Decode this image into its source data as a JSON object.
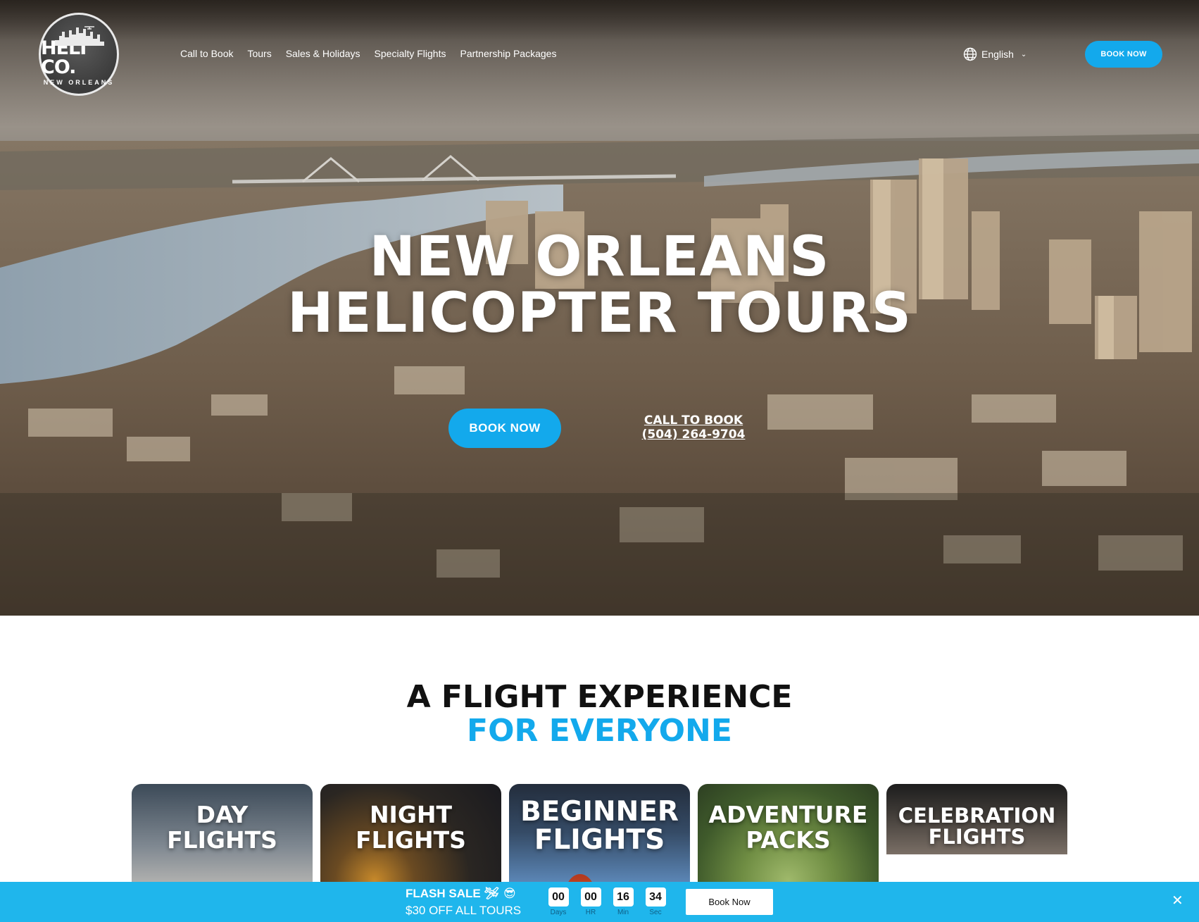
{
  "header": {
    "logo_brand": "HELI CO.",
    "logo_sub": "NEW ORLEANS",
    "nav": [
      "Call to Book",
      "Tours",
      "Sales & Holidays",
      "Specialty Flights",
      "Partnership Packages"
    ],
    "language": "English",
    "book_label": "BOOK NOW"
  },
  "hero": {
    "title_line1": "NEW ORLEANS",
    "title_line2": "HELICOPTER TOURS",
    "book_label": "BOOK NOW",
    "call_line1": "CALL TO BOOK",
    "call_line2": "(504) 264-9704"
  },
  "section": {
    "title_line1": "A FLIGHT EXPERIENCE",
    "title_line2": "FOR EVERYONE",
    "cards": [
      {
        "line1": "DAY",
        "line2": "FLIGHTS"
      },
      {
        "line1": "NIGHT",
        "line2": "FLIGHTS"
      },
      {
        "line1": "BEGINNER",
        "line2": "FLIGHTS"
      },
      {
        "line1": "ADVENTURE",
        "line2": "PACKS"
      },
      {
        "line1": "CELEBRATION",
        "line2": "FLIGHTS"
      }
    ]
  },
  "flash_bar": {
    "title": "FLASH SALE",
    "emoji": "🛩 😎",
    "subtitle": "$30 OFF ALL TOURS",
    "timer": [
      {
        "value": "00",
        "unit": "Days"
      },
      {
        "value": "00",
        "unit": "HR"
      },
      {
        "value": "16",
        "unit": "Min"
      },
      {
        "value": "34",
        "unit": "Sec"
      }
    ],
    "book_label": "Book Now",
    "close_glyph": "✕"
  },
  "colors": {
    "accent": "#13a9ec",
    "flash_bar": "#1fb6ec",
    "title_dark": "#111111"
  },
  "icons": [
    "globe-icon",
    "chevron-down-icon",
    "close-icon"
  ]
}
